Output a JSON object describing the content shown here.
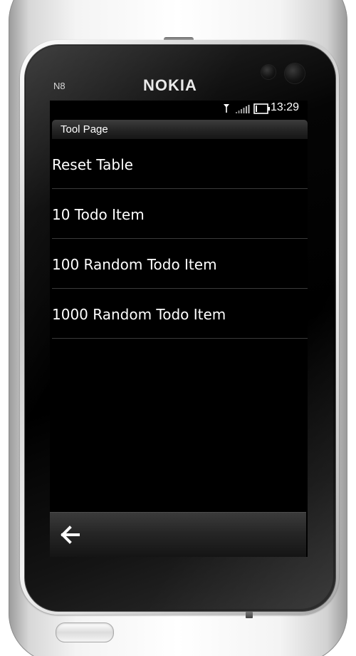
{
  "device": {
    "model": "N8",
    "brand": "NOKIA"
  },
  "status_bar": {
    "time": "13:29",
    "antenna_icon": "antenna-icon",
    "signal_icon": "signal-strength-icon",
    "battery_icon": "battery-icon"
  },
  "page": {
    "title": "Tool Page"
  },
  "menu": {
    "items": [
      {
        "label": "Reset Table"
      },
      {
        "label": "10 Todo Item"
      },
      {
        "label": "100 Random Todo Item"
      },
      {
        "label": "1000 Random Todo Item"
      }
    ]
  },
  "toolbar": {
    "back_icon": "back-arrow-icon"
  },
  "colors": {
    "screen_background": "#000000",
    "text": "#ffffff",
    "separator": "#3a3a3a"
  }
}
